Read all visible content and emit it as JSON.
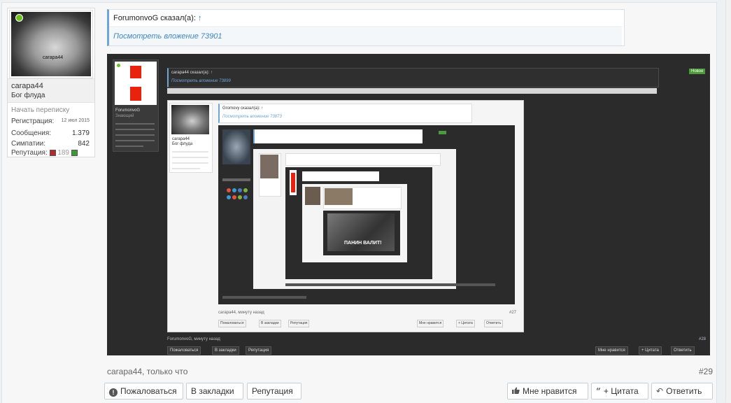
{
  "user": {
    "name": "carapa44",
    "title": "Бог флуда",
    "avatar_tag": "carapa44",
    "start_conversation": "Начать переписку",
    "stats": {
      "registration_label": "Регистрация:",
      "registration_value": "12 июл 2015",
      "messages_label": "Сообщения:",
      "messages_value": "1.379",
      "likes_label": "Симпатии:",
      "likes_value": "842",
      "reputation_label": "Репутация:",
      "reputation_value": "189"
    }
  },
  "quote": {
    "author_line": "ForumonvoG сказал(а):",
    "arrow": "↑",
    "attachment_link": "Посмотреть вложение 73901"
  },
  "embedded": {
    "outer_user": "ForumonvoG",
    "outer_user_title": "Знающий",
    "outer_quote": "carapa44 сказал(а): ↑",
    "outer_attachment": "Посмотреть вложение 73899",
    "new_badge": "Новое",
    "inner_user": "carapa44",
    "inner_user_title": "Бог флуда",
    "inner_quote": "Gromovy сказал(а): ↑",
    "inner_attachment": "Посмотреть вложение 73873",
    "inner_meta": "carapa44, минуту назад",
    "inner_num": "#27",
    "outer_meta": "ForumonvoG, минуту назад",
    "outer_num": "#28",
    "deep_caption": "ПАНИН ВАЛИТ!",
    "buttons": {
      "report": "Пожаловаться",
      "bookmark": "В закладки",
      "reputation": "Репутация",
      "like": "Мне нравится",
      "quote": "+ Цитата",
      "reply": "Ответить"
    }
  },
  "footer": {
    "meta": "carapa44, только что",
    "post_number": "#29",
    "report": "Пожаловаться",
    "bookmark": "В закладки",
    "reputation": "Репутация",
    "like": "Мне нравится",
    "quote": "+ Цитата",
    "reply": "Ответить"
  }
}
